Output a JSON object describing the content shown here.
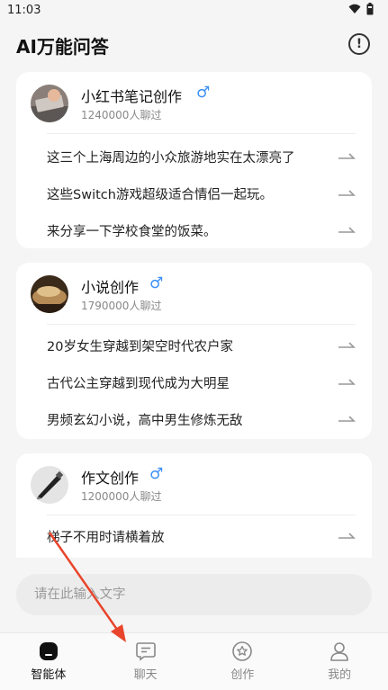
{
  "status_bar": {
    "time": "11:03"
  },
  "header": {
    "title": "AI万能问答"
  },
  "cards": [
    {
      "name": "小红书笔记创作",
      "count": "1240000人聊过",
      "prompts": [
        "这三个上海周边的小众旅游地实在太漂亮了",
        "这些Switch游戏超级适合情侣一起玩。",
        "来分享一下学校食堂的饭菜。"
      ]
    },
    {
      "name": "小说创作",
      "count": "1790000人聊过",
      "prompts": [
        "20岁女生穿越到架空时代农户家",
        "古代公主穿越到现代成为大明星",
        "男频玄幻小说，高中男生修炼无敌"
      ]
    },
    {
      "name": "作文创作",
      "count": "1200000人聊过",
      "prompts": [
        "梯子不用时请横着放"
      ]
    }
  ],
  "input": {
    "placeholder": "请在此输入文字"
  },
  "tabs": [
    {
      "label": "智能体",
      "icon": "agent-icon",
      "active": true
    },
    {
      "label": "聊天",
      "icon": "chat-icon",
      "active": false
    },
    {
      "label": "创作",
      "icon": "create-icon",
      "active": false
    },
    {
      "label": "我的",
      "icon": "profile-icon",
      "active": false
    }
  ],
  "colors": {
    "accent_gender": "#3b8ff5",
    "annotation_arrow": "#e8452c"
  }
}
